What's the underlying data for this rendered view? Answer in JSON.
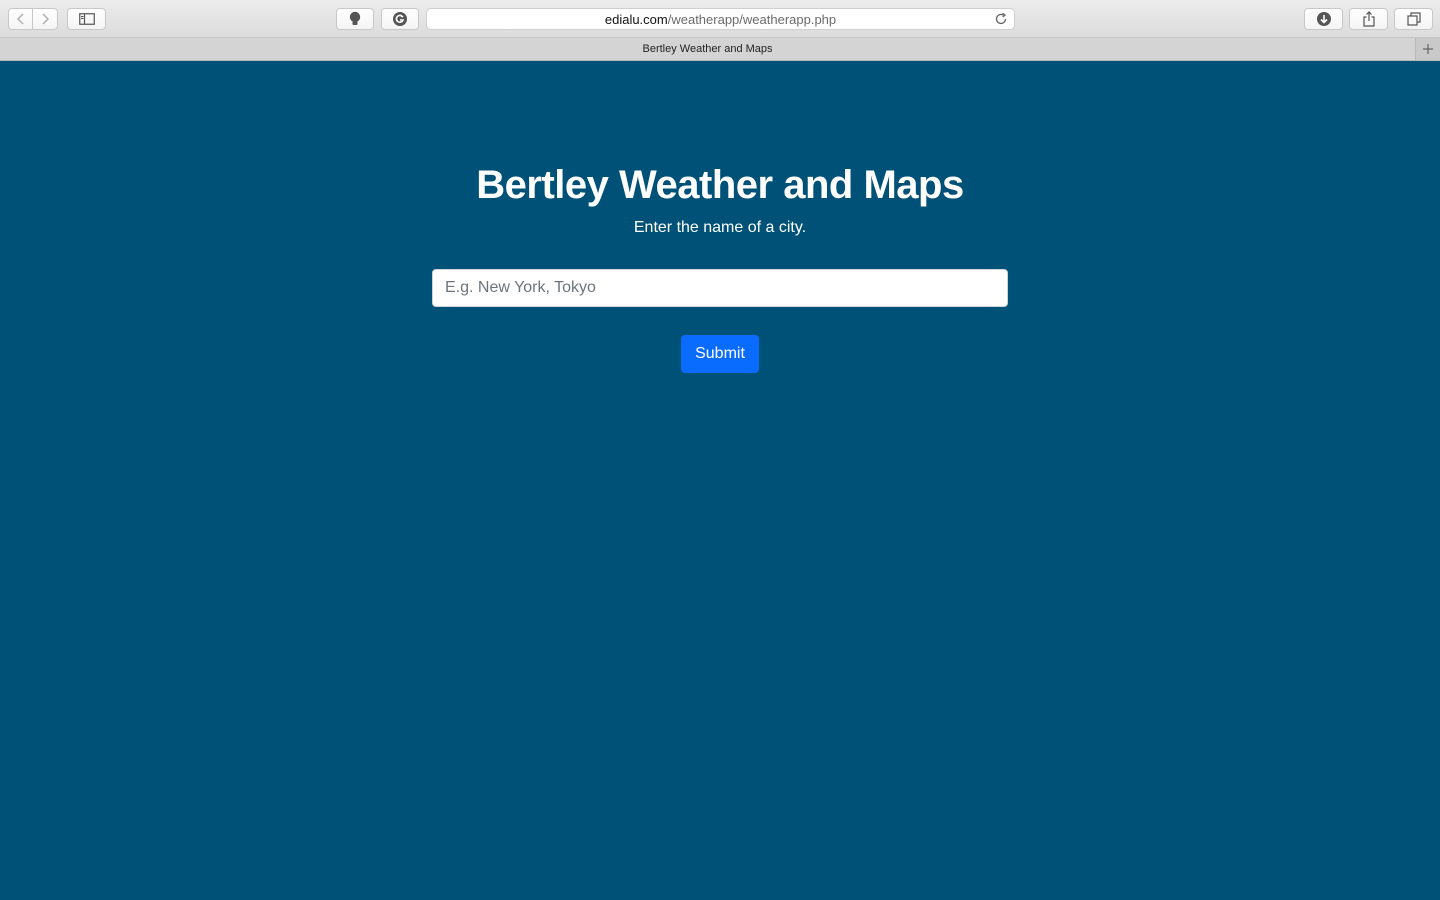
{
  "browser": {
    "url_domain": "edialu.com",
    "url_path": "/weatherapp/weatherapp.php",
    "tab_title": "Bertley Weather and Maps",
    "icons": [
      "back-icon",
      "forward-icon",
      "sidebar-icon",
      "lightbulb-icon",
      "grammarly-icon",
      "reload-icon",
      "download-icon",
      "share-icon",
      "tabs-overview-icon",
      "new-tab-icon"
    ]
  },
  "page": {
    "title": "Bertley Weather and Maps",
    "subtitle": "Enter the name of a city.",
    "search": {
      "placeholder": "E.g. New York, Tokyo",
      "value": ""
    },
    "submit_label": "Submit"
  },
  "colors": {
    "background": "#005177",
    "button": "#0a6cff",
    "text": "#ffffff"
  }
}
